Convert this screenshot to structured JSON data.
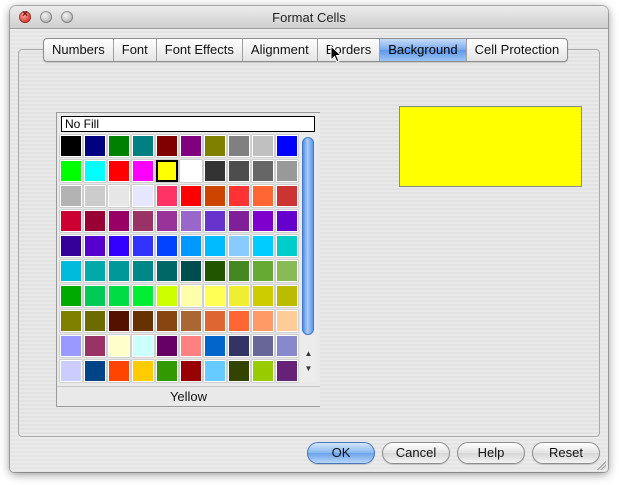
{
  "window": {
    "title": "Format Cells"
  },
  "tabs": [
    {
      "label": "Numbers",
      "active": false
    },
    {
      "label": "Font",
      "active": false
    },
    {
      "label": "Font Effects",
      "active": false
    },
    {
      "label": "Alignment",
      "active": false
    },
    {
      "label": "Borders",
      "active": false
    },
    {
      "label": "Background",
      "active": true
    },
    {
      "label": "Cell Protection",
      "active": false
    }
  ],
  "palette": {
    "no_fill_label": "No Fill",
    "selected_color_name": "Yellow",
    "colors": [
      "#000000",
      "#000080",
      "#008000",
      "#008080",
      "#800000",
      "#800080",
      "#808000",
      "#808080",
      "#c0c0c0",
      "#0000ff",
      "#00ff00",
      "#00ffff",
      "#ff0000",
      "#ff00ff",
      "#ffff00",
      "#ffffff",
      "#333333",
      "#4d4d4d",
      "#666666",
      "#999999",
      "#b3b3b3",
      "#cccccc",
      "#e6e6e6",
      "#e6e6ff",
      "#ff3366",
      "#ff0000",
      "#cc4400",
      "#ff3333",
      "#ff6633",
      "#cc3333",
      "#cc0033",
      "#990033",
      "#990066",
      "#993366",
      "#993399",
      "#9966cc",
      "#6633cc",
      "#7f1f99",
      "#7f00cc",
      "#6600cc",
      "#330099",
      "#5500cc",
      "#3300ff",
      "#3333ff",
      "#0044ff",
      "#0099ff",
      "#00bbff",
      "#88ccff",
      "#00ccff",
      "#00cccc",
      "#00bbdd",
      "#00aaaa",
      "#009999",
      "#008888",
      "#006666",
      "#004d4d",
      "#225500",
      "#448822",
      "#66aa33",
      "#88bb55",
      "#00aa00",
      "#00cc55",
      "#00dd44",
      "#00ee33",
      "#ccff00",
      "#ffffaa",
      "#ffff55",
      "#eeee33",
      "#cccc00",
      "#bbbb00",
      "#808000",
      "#6b6b00",
      "#551100",
      "#663300",
      "#884411",
      "#aa6633",
      "#dd6633",
      "#ff6633",
      "#ff9966",
      "#ffcc99",
      "#9999ff",
      "#993366",
      "#ffffcc",
      "#ccffff",
      "#660066",
      "#ff8080",
      "#0066cc",
      "#333366",
      "#666699",
      "#8888cc",
      "#ccccff",
      "#004488",
      "#ff4400",
      "#ffcc00",
      "#339900",
      "#990000",
      "#66ccff",
      "#334400",
      "#99cc00",
      "#662277"
    ],
    "selected_index": 14
  },
  "preview": {
    "color": "#ffff00"
  },
  "buttons": {
    "ok": "OK",
    "cancel": "Cancel",
    "help": "Help",
    "reset": "Reset"
  }
}
